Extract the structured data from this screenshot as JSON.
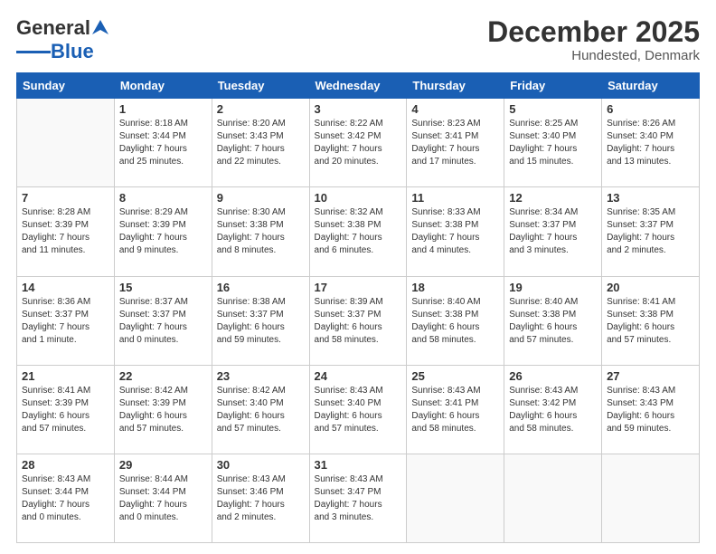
{
  "logo": {
    "line1": "General",
    "line2": "Blue"
  },
  "title": "December 2025",
  "subtitle": "Hundested, Denmark",
  "days_header": [
    "Sunday",
    "Monday",
    "Tuesday",
    "Wednesday",
    "Thursday",
    "Friday",
    "Saturday"
  ],
  "weeks": [
    [
      {
        "day": "",
        "info": ""
      },
      {
        "day": "1",
        "info": "Sunrise: 8:18 AM\nSunset: 3:44 PM\nDaylight: 7 hours\nand 25 minutes."
      },
      {
        "day": "2",
        "info": "Sunrise: 8:20 AM\nSunset: 3:43 PM\nDaylight: 7 hours\nand 22 minutes."
      },
      {
        "day": "3",
        "info": "Sunrise: 8:22 AM\nSunset: 3:42 PM\nDaylight: 7 hours\nand 20 minutes."
      },
      {
        "day": "4",
        "info": "Sunrise: 8:23 AM\nSunset: 3:41 PM\nDaylight: 7 hours\nand 17 minutes."
      },
      {
        "day": "5",
        "info": "Sunrise: 8:25 AM\nSunset: 3:40 PM\nDaylight: 7 hours\nand 15 minutes."
      },
      {
        "day": "6",
        "info": "Sunrise: 8:26 AM\nSunset: 3:40 PM\nDaylight: 7 hours\nand 13 minutes."
      }
    ],
    [
      {
        "day": "7",
        "info": "Sunrise: 8:28 AM\nSunset: 3:39 PM\nDaylight: 7 hours\nand 11 minutes."
      },
      {
        "day": "8",
        "info": "Sunrise: 8:29 AM\nSunset: 3:39 PM\nDaylight: 7 hours\nand 9 minutes."
      },
      {
        "day": "9",
        "info": "Sunrise: 8:30 AM\nSunset: 3:38 PM\nDaylight: 7 hours\nand 8 minutes."
      },
      {
        "day": "10",
        "info": "Sunrise: 8:32 AM\nSunset: 3:38 PM\nDaylight: 7 hours\nand 6 minutes."
      },
      {
        "day": "11",
        "info": "Sunrise: 8:33 AM\nSunset: 3:38 PM\nDaylight: 7 hours\nand 4 minutes."
      },
      {
        "day": "12",
        "info": "Sunrise: 8:34 AM\nSunset: 3:37 PM\nDaylight: 7 hours\nand 3 minutes."
      },
      {
        "day": "13",
        "info": "Sunrise: 8:35 AM\nSunset: 3:37 PM\nDaylight: 7 hours\nand 2 minutes."
      }
    ],
    [
      {
        "day": "14",
        "info": "Sunrise: 8:36 AM\nSunset: 3:37 PM\nDaylight: 7 hours\nand 1 minute."
      },
      {
        "day": "15",
        "info": "Sunrise: 8:37 AM\nSunset: 3:37 PM\nDaylight: 7 hours\nand 0 minutes."
      },
      {
        "day": "16",
        "info": "Sunrise: 8:38 AM\nSunset: 3:37 PM\nDaylight: 6 hours\nand 59 minutes."
      },
      {
        "day": "17",
        "info": "Sunrise: 8:39 AM\nSunset: 3:37 PM\nDaylight: 6 hours\nand 58 minutes."
      },
      {
        "day": "18",
        "info": "Sunrise: 8:40 AM\nSunset: 3:38 PM\nDaylight: 6 hours\nand 58 minutes."
      },
      {
        "day": "19",
        "info": "Sunrise: 8:40 AM\nSunset: 3:38 PM\nDaylight: 6 hours\nand 57 minutes."
      },
      {
        "day": "20",
        "info": "Sunrise: 8:41 AM\nSunset: 3:38 PM\nDaylight: 6 hours\nand 57 minutes."
      }
    ],
    [
      {
        "day": "21",
        "info": "Sunrise: 8:41 AM\nSunset: 3:39 PM\nDaylight: 6 hours\nand 57 minutes."
      },
      {
        "day": "22",
        "info": "Sunrise: 8:42 AM\nSunset: 3:39 PM\nDaylight: 6 hours\nand 57 minutes."
      },
      {
        "day": "23",
        "info": "Sunrise: 8:42 AM\nSunset: 3:40 PM\nDaylight: 6 hours\nand 57 minutes."
      },
      {
        "day": "24",
        "info": "Sunrise: 8:43 AM\nSunset: 3:40 PM\nDaylight: 6 hours\nand 57 minutes."
      },
      {
        "day": "25",
        "info": "Sunrise: 8:43 AM\nSunset: 3:41 PM\nDaylight: 6 hours\nand 58 minutes."
      },
      {
        "day": "26",
        "info": "Sunrise: 8:43 AM\nSunset: 3:42 PM\nDaylight: 6 hours\nand 58 minutes."
      },
      {
        "day": "27",
        "info": "Sunrise: 8:43 AM\nSunset: 3:43 PM\nDaylight: 6 hours\nand 59 minutes."
      }
    ],
    [
      {
        "day": "28",
        "info": "Sunrise: 8:43 AM\nSunset: 3:44 PM\nDaylight: 7 hours\nand 0 minutes."
      },
      {
        "day": "29",
        "info": "Sunrise: 8:44 AM\nSunset: 3:44 PM\nDaylight: 7 hours\nand 0 minutes."
      },
      {
        "day": "30",
        "info": "Sunrise: 8:43 AM\nSunset: 3:46 PM\nDaylight: 7 hours\nand 2 minutes."
      },
      {
        "day": "31",
        "info": "Sunrise: 8:43 AM\nSunset: 3:47 PM\nDaylight: 7 hours\nand 3 minutes."
      },
      {
        "day": "",
        "info": ""
      },
      {
        "day": "",
        "info": ""
      },
      {
        "day": "",
        "info": ""
      }
    ]
  ]
}
